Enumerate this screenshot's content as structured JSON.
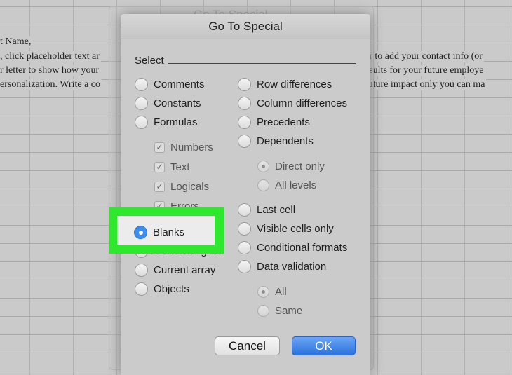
{
  "sheet": {
    "lines": [
      "t Name,",
      ", click placeholder text ar",
      "r letter to show how your",
      "ersonalization. Write a co"
    ],
    "right_lines": [
      "er to add your contact info (or",
      "esults for your future employe",
      "future impact only you can ma"
    ]
  },
  "ghost_title": "Go To Special",
  "dialog": {
    "title": "Go To Special",
    "section": "Select",
    "left": [
      {
        "label": "Comments"
      },
      {
        "label": "Constants"
      },
      {
        "label": "Formulas"
      }
    ],
    "formula_checks": [
      {
        "label": "Numbers",
        "checked": true
      },
      {
        "label": "Text",
        "checked": true
      },
      {
        "label": "Logicals",
        "checked": true
      },
      {
        "label": "Errors",
        "checked": true
      }
    ],
    "left2": [
      {
        "label": "Blanks",
        "selected": true
      },
      {
        "label": "Current region"
      },
      {
        "label": "Current array"
      },
      {
        "label": "Objects"
      }
    ],
    "right": [
      {
        "label": "Row differences"
      },
      {
        "label": "Column differences"
      },
      {
        "label": "Precedents"
      },
      {
        "label": "Dependents"
      }
    ],
    "dependents_sub": [
      {
        "label": "Direct only",
        "selected": true
      },
      {
        "label": "All levels"
      }
    ],
    "right2": [
      {
        "label": "Last cell"
      },
      {
        "label": "Visible cells only"
      },
      {
        "label": "Conditional formats"
      },
      {
        "label": "Data validation"
      }
    ],
    "validation_sub": [
      {
        "label": "All",
        "selected": true
      },
      {
        "label": "Same"
      }
    ],
    "cancel": "Cancel",
    "ok": "OK"
  },
  "colors": {
    "highlight": "#2ee82e",
    "ok": "#2a72de",
    "selected_radio": "#3a8ef0"
  }
}
